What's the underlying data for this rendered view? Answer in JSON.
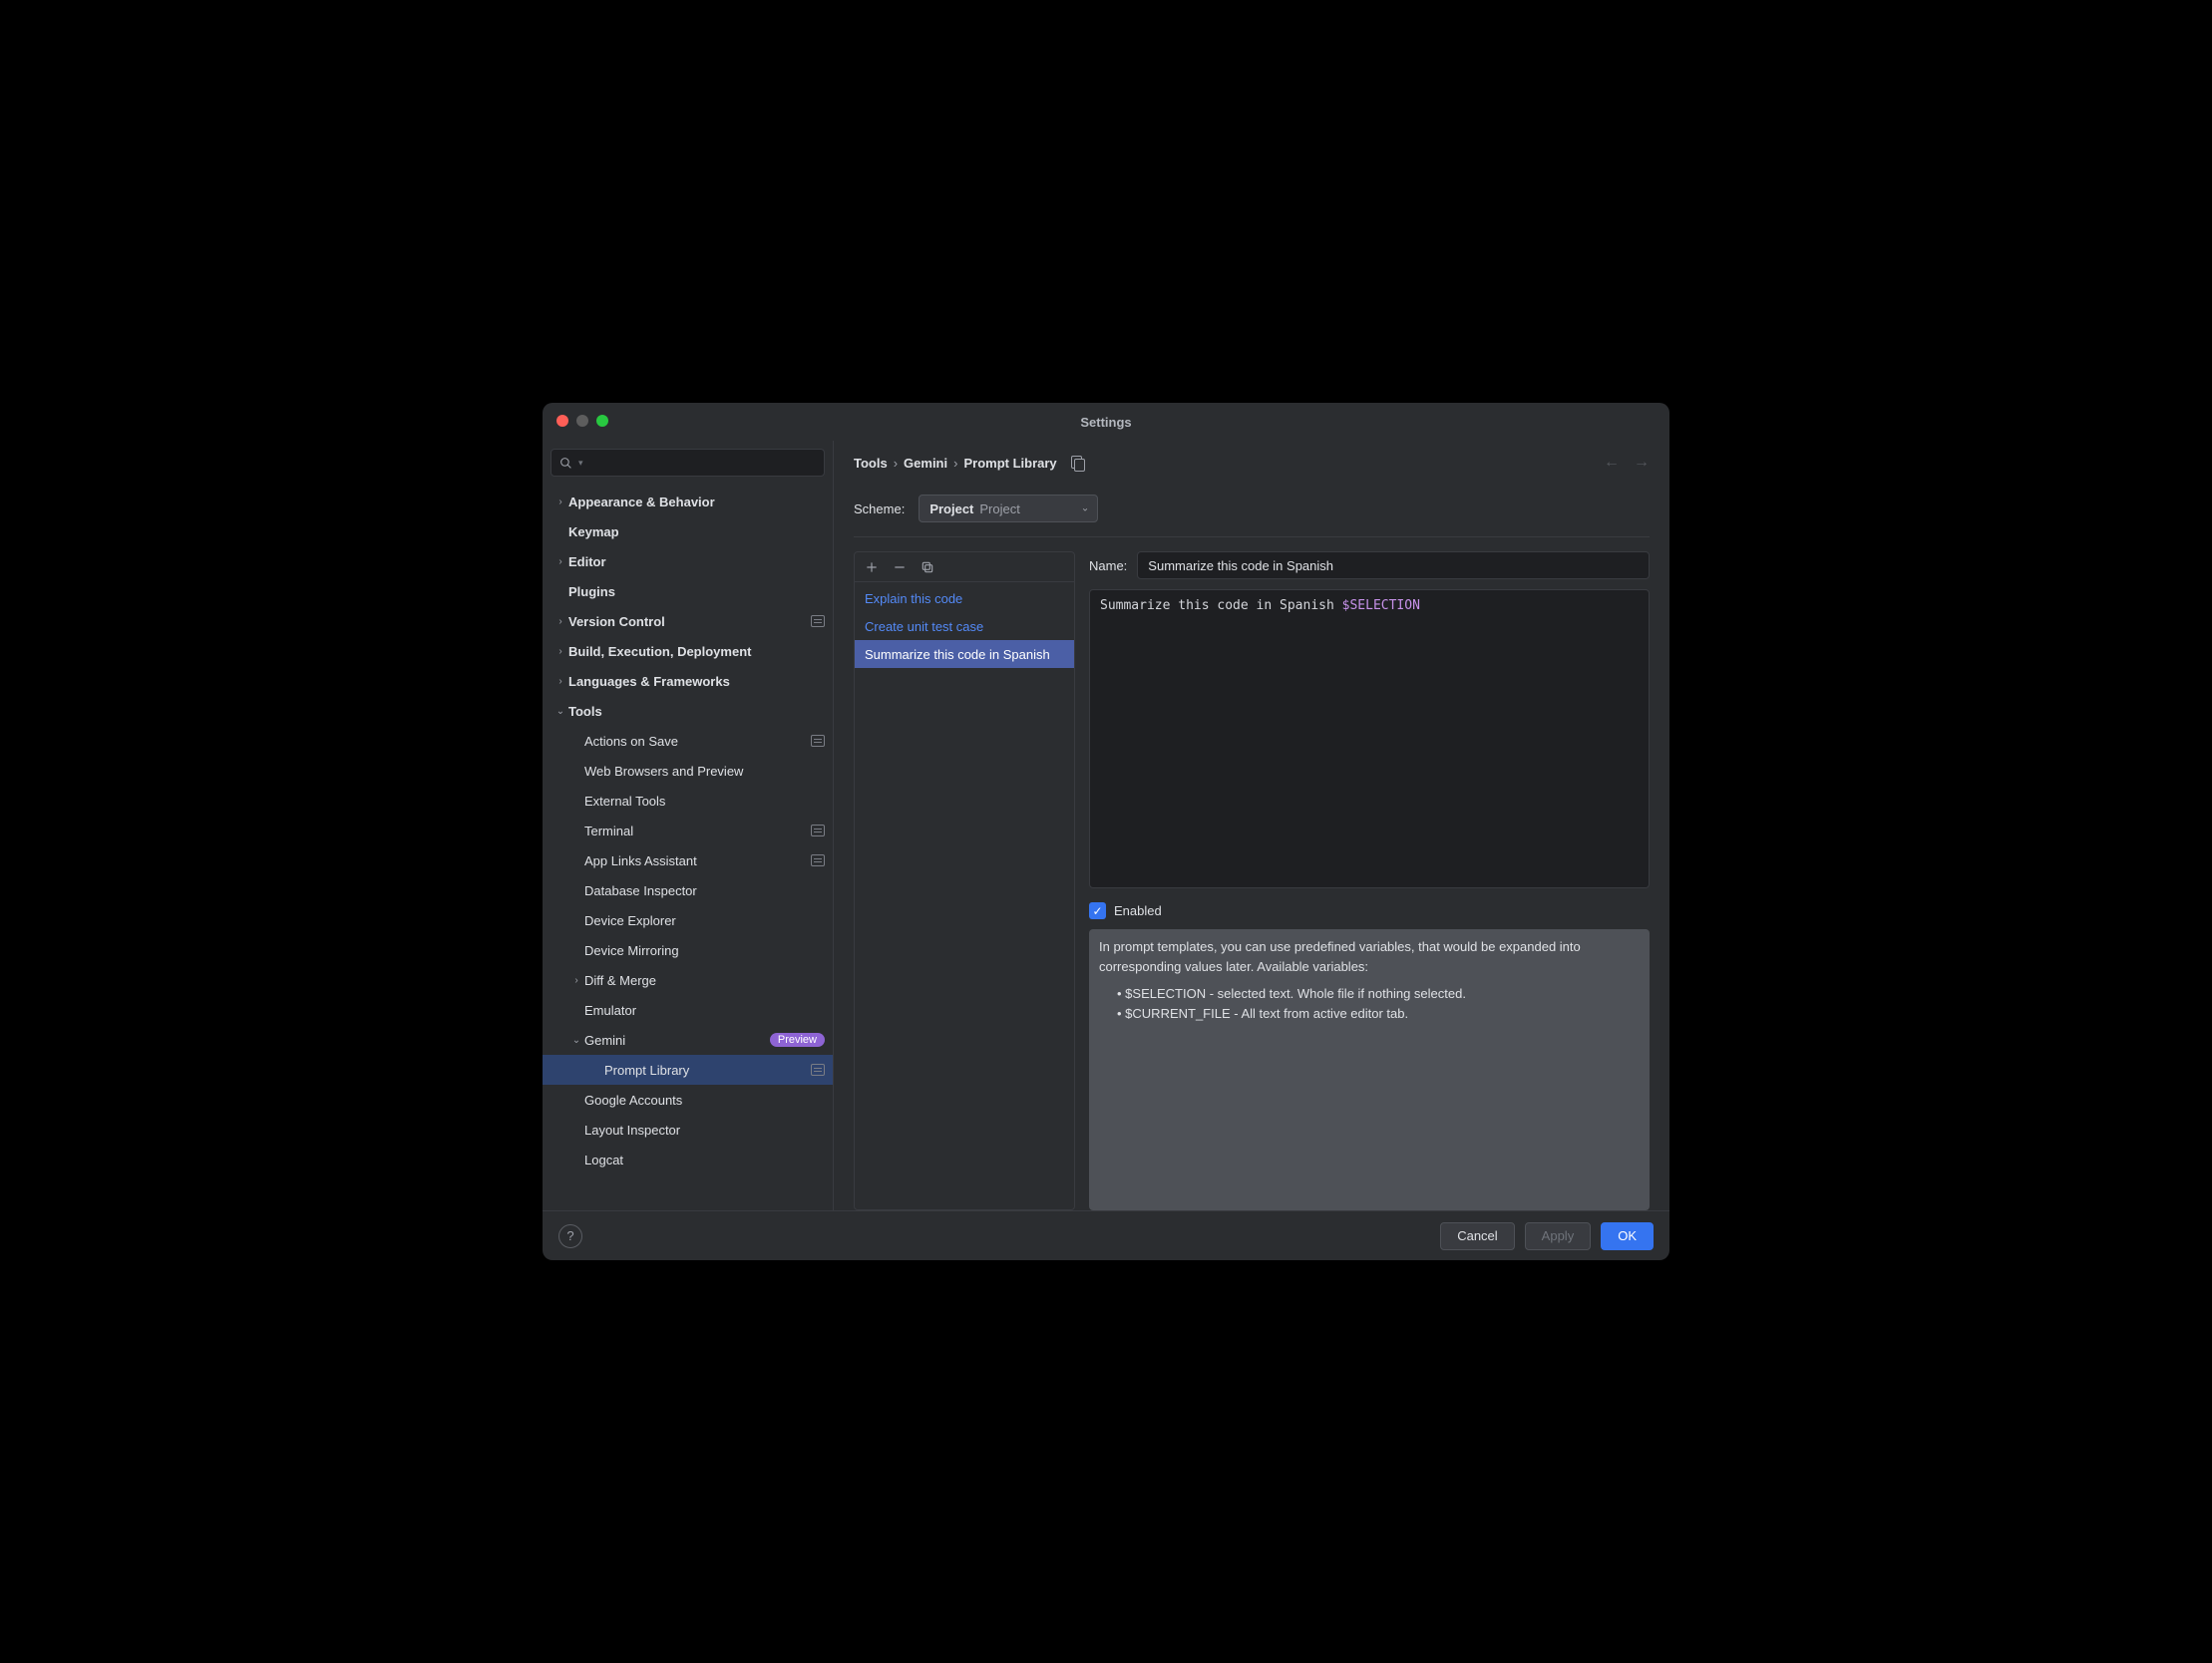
{
  "title": "Settings",
  "search": {
    "placeholder": ""
  },
  "sidebar": {
    "items": [
      {
        "label": "Appearance & Behavior",
        "chevron": "right",
        "bold": true,
        "indent": 0
      },
      {
        "label": "Keymap",
        "bold": true,
        "indent": 0
      },
      {
        "label": "Editor",
        "chevron": "right",
        "bold": true,
        "indent": 0
      },
      {
        "label": "Plugins",
        "bold": true,
        "indent": 0
      },
      {
        "label": "Version Control",
        "chevron": "right",
        "bold": true,
        "indent": 0,
        "modified": true
      },
      {
        "label": "Build, Execution, Deployment",
        "chevron": "right",
        "bold": true,
        "indent": 0
      },
      {
        "label": "Languages & Frameworks",
        "chevron": "right",
        "bold": true,
        "indent": 0
      },
      {
        "label": "Tools",
        "chevron": "down",
        "bold": true,
        "indent": 0
      },
      {
        "label": "Actions on Save",
        "indent": 1,
        "modified": true
      },
      {
        "label": "Web Browsers and Preview",
        "indent": 1
      },
      {
        "label": "External Tools",
        "indent": 1
      },
      {
        "label": "Terminal",
        "indent": 1,
        "modified": true
      },
      {
        "label": "App Links Assistant",
        "indent": 1,
        "modified": true
      },
      {
        "label": "Database Inspector",
        "indent": 1
      },
      {
        "label": "Device Explorer",
        "indent": 1
      },
      {
        "label": "Device Mirroring",
        "indent": 1
      },
      {
        "label": "Diff & Merge",
        "chevron": "right",
        "indent": 1
      },
      {
        "label": "Emulator",
        "indent": 1
      },
      {
        "label": "Gemini",
        "chevron": "down",
        "indent": 1,
        "badge": "Preview"
      },
      {
        "label": "Prompt Library",
        "indent": 2,
        "selected": true,
        "modified": true
      },
      {
        "label": "Google Accounts",
        "indent": 1
      },
      {
        "label": "Layout Inspector",
        "indent": 1
      },
      {
        "label": "Logcat",
        "indent": 1
      }
    ]
  },
  "breadcrumb": [
    "Tools",
    "Gemini",
    "Prompt Library"
  ],
  "scheme": {
    "label": "Scheme:",
    "value": "Project",
    "secondary": "Project"
  },
  "prompt_list": [
    {
      "label": "Explain this code"
    },
    {
      "label": "Create unit test case"
    },
    {
      "label": "Summarize this code in Spanish",
      "selected": true
    }
  ],
  "detail": {
    "name_label": "Name:",
    "name_value": "Summarize this code in Spanish",
    "body_text": "Summarize this code in Spanish ",
    "body_var": "$SELECTION",
    "enabled_label": "Enabled",
    "enabled": true
  },
  "help": {
    "intro": "In prompt templates, you can use predefined variables, that would be expanded into corresponding values later. Available variables:",
    "items": [
      "$SELECTION - selected text. Whole file if nothing selected.",
      "$CURRENT_FILE - All text from active editor tab."
    ]
  },
  "footer": {
    "cancel": "Cancel",
    "apply": "Apply",
    "ok": "OK"
  }
}
